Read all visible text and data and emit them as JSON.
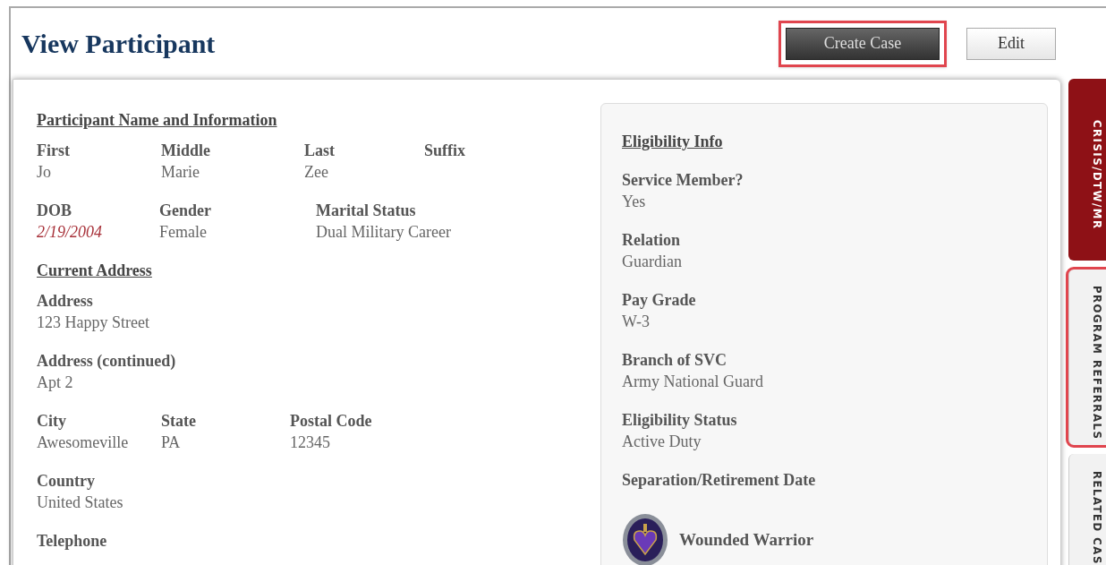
{
  "title": "View Participant",
  "actions": [
    {
      "label": "Create Case",
      "kind": "primary",
      "highlighted": true
    },
    {
      "label": "Edit",
      "kind": "secondary",
      "highlighted": false
    }
  ],
  "sections": [
    {
      "heading": "Participant Name and Information",
      "rows": [
        [
          {
            "label": "First",
            "value": "Jo"
          },
          {
            "label": "Middle",
            "value": "Marie"
          },
          {
            "label": "Last",
            "value": "Zee"
          },
          {
            "label": "Suffix"
          }
        ],
        [
          {
            "label": "DOB",
            "value": "2/19/2004",
            "alert": true
          },
          {
            "label": "Gender",
            "value": "Female"
          },
          {
            "label": "Marital Status",
            "value": "Dual Military Career"
          }
        ]
      ]
    },
    {
      "heading": "Current Address",
      "rows": [
        [
          {
            "label": "Address",
            "value": "123 Happy Street"
          }
        ],
        [
          {
            "label": "Address (continued)",
            "value": "Apt 2"
          }
        ],
        [
          {
            "label": "City",
            "value": "Awesomeville"
          },
          {
            "label": "State",
            "value": "PA"
          },
          {
            "label": "Postal Code",
            "value": "12345"
          }
        ],
        [
          {
            "label": "Country",
            "value": "United States"
          }
        ],
        [
          {
            "label": "Telephone"
          }
        ]
      ]
    }
  ],
  "eligibility": {
    "heading": "Eligibility Info",
    "fields": [
      {
        "label": "Service Member?",
        "value": "Yes"
      },
      {
        "label": "Relation",
        "value": "Guardian"
      },
      {
        "label": "Pay Grade",
        "value": "W-3"
      },
      {
        "label": "Branch of SVC",
        "value": "Army National Guard"
      },
      {
        "label": "Eligibility Status",
        "value": "Active Duty"
      },
      {
        "label": "Separation/Retirement Date"
      }
    ],
    "badge": {
      "label": "Wounded Warrior"
    }
  },
  "side_tabs": [
    {
      "label": "CRISIS/DTW/MR",
      "selected": true,
      "highlighted": false
    },
    {
      "label": "PROGRAM REFERRALS",
      "selected": false,
      "highlighted": true
    },
    {
      "label": "RELATED CAS",
      "selected": false,
      "highlighted": false
    }
  ]
}
